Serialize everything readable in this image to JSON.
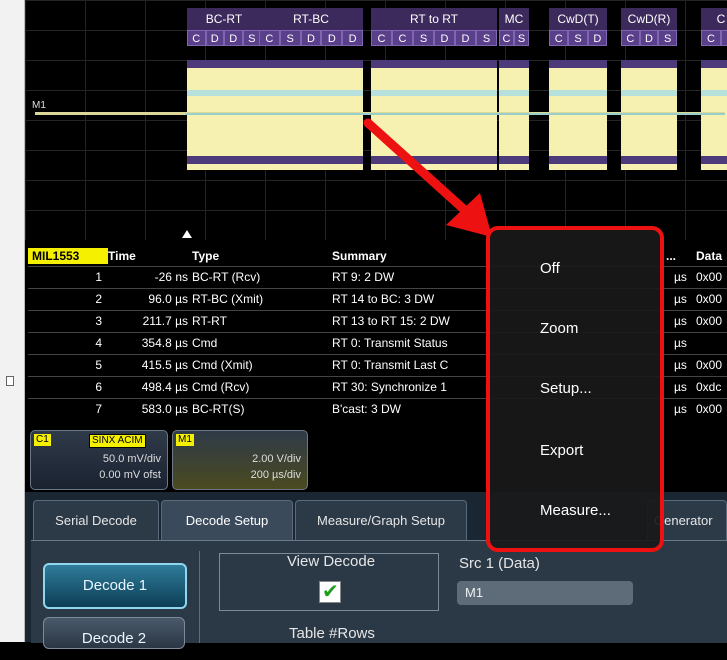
{
  "waveform": {
    "trace_label": "M1",
    "segments": [
      {
        "name": "BC-RT",
        "fields": [
          "C",
          "D",
          "D",
          "S"
        ]
      },
      {
        "name": "RT-BC",
        "fields": [
          "C",
          "S",
          "D",
          "D",
          "D"
        ]
      },
      {
        "name": "RT to RT",
        "fields": [
          "C",
          "C",
          "S",
          "D",
          "D",
          "S"
        ]
      },
      {
        "name": "MC",
        "fields": [
          "C",
          "S"
        ]
      },
      {
        "name": "CwD(T)",
        "fields": [
          "C",
          "S",
          "D"
        ]
      },
      {
        "name": "CwD(R)",
        "fields": [
          "C",
          "D",
          "S"
        ]
      },
      {
        "name": "C",
        "fields": [
          "C",
          "D"
        ]
      }
    ]
  },
  "table": {
    "tag": "MIL1553",
    "headers": {
      "time": "Time",
      "type": "Type",
      "summary": "Summary",
      "truncated": "...",
      "data": "Data"
    },
    "rows": [
      {
        "idx": "1",
        "time": "-26 ns",
        "type": "BC-RT  (Rcv)",
        "summary": "RT  9: 2 DW",
        "unit": "µs",
        "data": "0x00"
      },
      {
        "idx": "2",
        "time": "96.0 µs",
        "type": "RT-BC  (Xmit)",
        "summary": "RT 14 to BC: 3 DW",
        "unit": "µs",
        "data": "0x00"
      },
      {
        "idx": "3",
        "time": "211.7 µs",
        "type": "RT-RT",
        "summary": "RT 13 to RT 15: 2 DW",
        "unit": "µs",
        "data": "0x00"
      },
      {
        "idx": "4",
        "time": "354.8 µs",
        "type": "Cmd",
        "summary": "RT  0: Transmit Status",
        "unit": "µs",
        "data": ""
      },
      {
        "idx": "5",
        "time": "415.5 µs",
        "type": "Cmd  (Xmit)",
        "summary": "RT  0: Transmit Last C",
        "unit": "µs",
        "data": "0x00"
      },
      {
        "idx": "6",
        "time": "498.4 µs",
        "type": "Cmd  (Rcv)",
        "summary": "RT 30: Synchronize 1",
        "unit": "µs",
        "data": "0xdc"
      },
      {
        "idx": "7",
        "time": "583.0 µs",
        "type": "BC-RT(S)",
        "summary": "B'cast: 3 DW",
        "unit": "µs",
        "data": "0x00"
      }
    ]
  },
  "descriptors": {
    "c1": {
      "tag": "C1",
      "coupling": "SINX ACIM",
      "scale": "50.0 mV/div",
      "offset": "0.00 mV ofst"
    },
    "m1": {
      "tag": "M1",
      "scale": "2.00 V/div",
      "timebase": "200 µs/div"
    }
  },
  "tabs": [
    "Serial Decode",
    "Decode Setup",
    "Measure/Graph Setup",
    "Generator"
  ],
  "decode_setup": {
    "decode1": "Decode 1",
    "decode2": "Decode 2",
    "view_decode_label": "View Decode",
    "view_decode_checked": true,
    "src1_label": "Src 1 (Data)",
    "src1_value": "M1",
    "table_rows_label": "Table #Rows"
  },
  "context_menu": {
    "items": [
      "Off",
      "Zoom",
      "Setup...",
      "Export",
      "Measure..."
    ]
  },
  "colors": {
    "trace": "#f6f1b0",
    "segment": "#3c2a5c",
    "highlight": "#e11",
    "tag": "#f5f000"
  }
}
